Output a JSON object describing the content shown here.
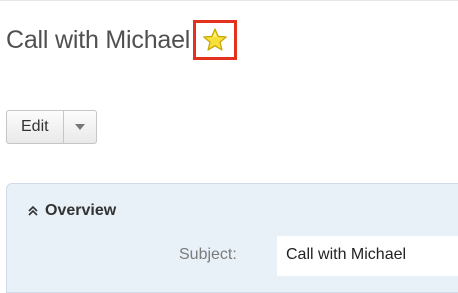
{
  "header": {
    "title": "Call with Michael",
    "favorite": {
      "icon": "star-icon",
      "state": "favorited",
      "star_color": "#f7e03a",
      "highlight_color": "#e2311d"
    }
  },
  "actions": {
    "edit_label": "Edit",
    "dropdown_icon": "caret-down-icon"
  },
  "panel": {
    "title": "Overview",
    "collapse_icon": "double-chevron-up-icon",
    "fields": [
      {
        "label": "Subject:",
        "value": "Call with Michael"
      }
    ]
  }
}
